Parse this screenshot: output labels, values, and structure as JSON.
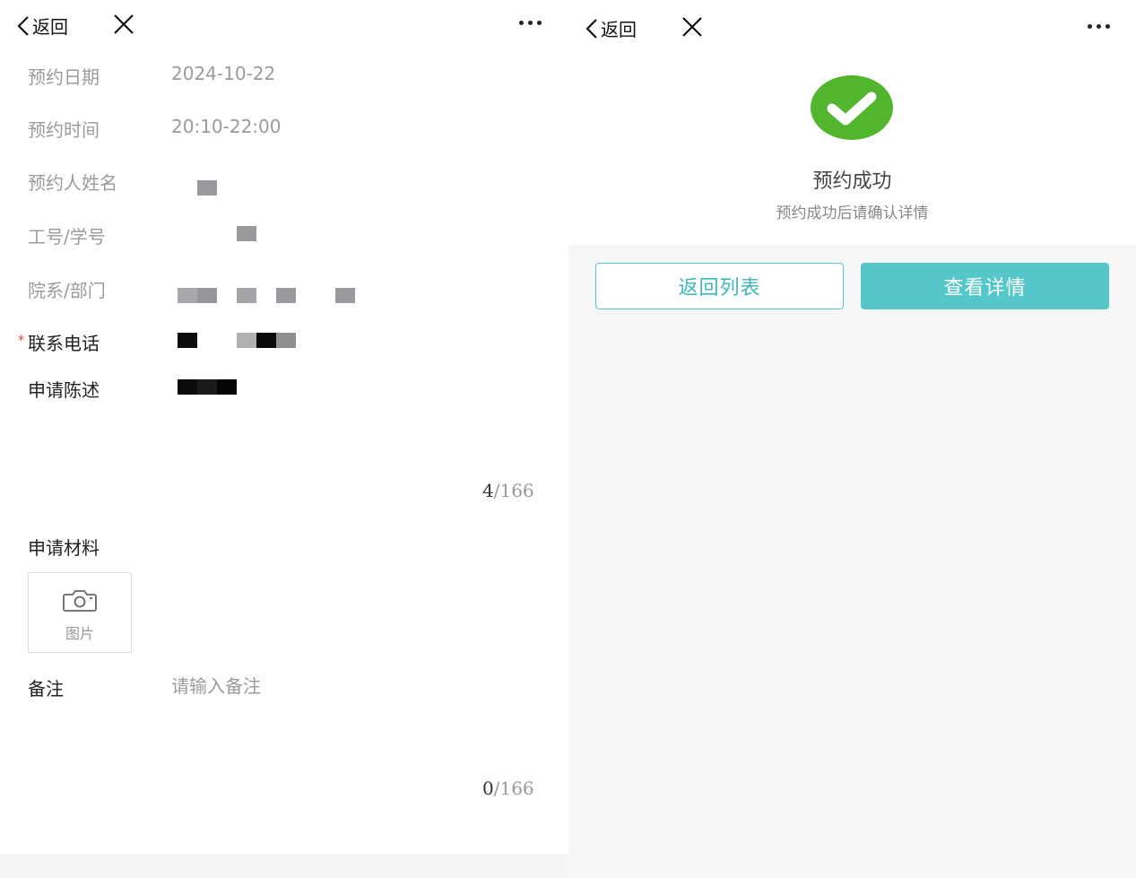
{
  "left": {
    "nav": {
      "back_label": "返回"
    },
    "fields": {
      "date": {
        "label": "预约日期",
        "value": "2024-10-22"
      },
      "time": {
        "label": "预约时间",
        "value": "20:10-22:00"
      },
      "name": {
        "label": "预约人姓名"
      },
      "id_no": {
        "label": "工号/学号"
      },
      "dept": {
        "label": "院系/部门"
      },
      "phone": {
        "label": "联系电话",
        "required_mark": "*"
      },
      "statement": {
        "label": "申请陈述",
        "count_current": "4",
        "count_max": "/166"
      },
      "materials": {
        "label": "申请材料",
        "upload_label": "图片"
      },
      "remark": {
        "label": "备注",
        "placeholder": "请输入备注",
        "count_current": "0",
        "count_max": "/166"
      }
    }
  },
  "right": {
    "nav": {
      "back_label": "返回"
    },
    "success": {
      "title": "预约成功",
      "subtitle": "预约成功后请确认详情",
      "color": "#52b52e"
    },
    "buttons": {
      "back_to_list": "返回列表",
      "view_details": "查看详情"
    },
    "accent_color": "#55c6c9"
  }
}
